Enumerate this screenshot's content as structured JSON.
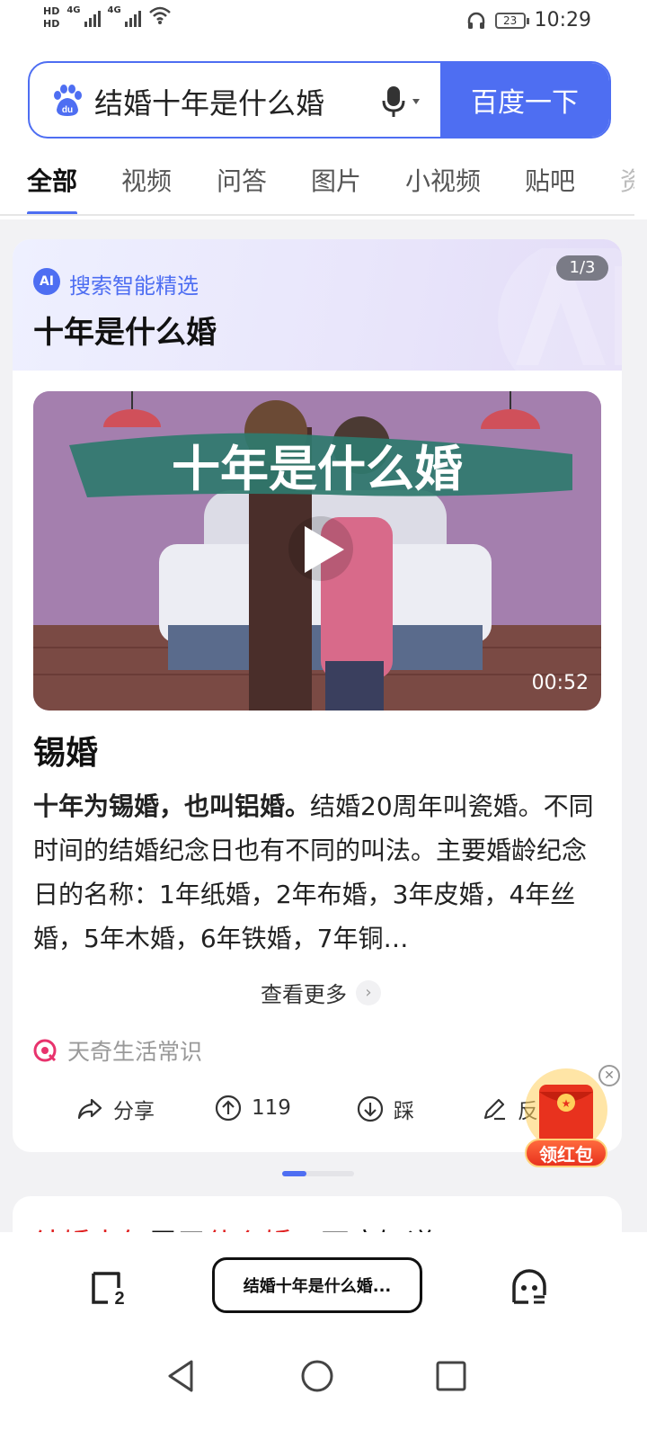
{
  "status_bar": {
    "hd_top": "HD",
    "hd_bottom": "HD",
    "network_1": "4G",
    "network_2": "4G",
    "battery": "23",
    "time": "10:29"
  },
  "search": {
    "query": "结婚十年是什么婚",
    "button_label": "百度一下"
  },
  "tabs": [
    {
      "label": "全部",
      "active": true
    },
    {
      "label": "视频",
      "active": false
    },
    {
      "label": "问答",
      "active": false
    },
    {
      "label": "图片",
      "active": false
    },
    {
      "label": "小视频",
      "active": false
    },
    {
      "label": "贴吧",
      "active": false
    },
    {
      "label": "资",
      "active": false
    }
  ],
  "ai_card": {
    "badge": "AI",
    "label": "搜索智能精选",
    "title": "十年是什么婚",
    "pager": "1/3",
    "video": {
      "caption": "十年是什么婚",
      "duration": "00:52"
    },
    "answer_title": "锡婚",
    "answer_lead": "十年为锡婚，也叫铝婚。",
    "answer_rest": "结婚20周年叫瓷婚。不同时间的结婚纪念日也有不同的叫法。主要婚龄纪念日的名称：1年纸婚，2年布婚，3年皮婚，4年丝婚，5年木婚，6年铁婚，7年铜…",
    "more_label": "查看更多",
    "source": "天奇生活常识",
    "actions": {
      "share": "分享",
      "upvote_count": "119",
      "downvote": "踩",
      "feedback": "反"
    }
  },
  "carousel": {
    "index": 1,
    "total": 3
  },
  "next_result": {
    "title_red_1": "结婚十年",
    "title_black_1": "属于",
    "title_red_2": "什么婚",
    "title_black_2": "，不应知道"
  },
  "red_packet": {
    "label": "领红包"
  },
  "bottom_bar": {
    "tab_count": "2",
    "query_pill": "结婚十年是什么婚..."
  },
  "colors": {
    "brand_blue": "#4e6ef2",
    "highlight_red": "#e02020"
  }
}
